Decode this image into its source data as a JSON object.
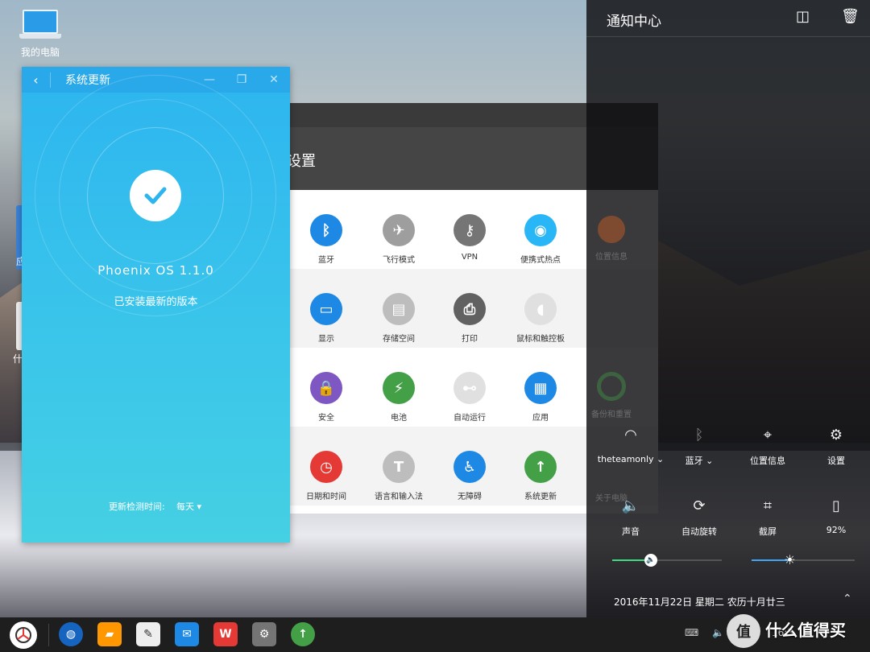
{
  "desktop": {
    "computer_label": "我的电脑",
    "peek_label_1": "应",
    "peek_label_2": "什"
  },
  "settings_window": {
    "title": "设置",
    "rows": [
      [
        {
          "label": "蓝牙",
          "icon": "bluetooth-icon",
          "color": "#1e88e5"
        },
        {
          "label": "飞行模式",
          "icon": "airplane-icon",
          "color": "#9e9e9e"
        },
        {
          "label": "VPN",
          "icon": "vpn-key-icon",
          "color": "#757575"
        },
        {
          "label": "便携式热点",
          "icon": "hotspot-icon",
          "color": "#29b6f6"
        }
      ],
      [
        {
          "label": "显示",
          "icon": "display-icon",
          "color": "#1e88e5"
        },
        {
          "label": "存储空间",
          "icon": "storage-icon",
          "color": "#bdbdbd"
        },
        {
          "label": "打印",
          "icon": "printer-icon",
          "color": "#616161"
        },
        {
          "label": "鼠标和触控板",
          "icon": "mouse-icon",
          "color": "#e0e0e0"
        }
      ],
      [
        {
          "label": "安全",
          "icon": "lock-icon",
          "color": "#7e57c2"
        },
        {
          "label": "电池",
          "icon": "battery-icon",
          "color": "#43a047"
        },
        {
          "label": "自动运行",
          "icon": "toggle-icon",
          "color": "#e0e0e0"
        },
        {
          "label": "应用",
          "icon": "apps-grid-icon",
          "color": "#1e88e5"
        }
      ],
      [
        {
          "label": "日期和时间",
          "icon": "clock-icon",
          "color": "#e53935"
        },
        {
          "label": "语言和输入法",
          "icon": "keyboard-text-icon",
          "color": "#bdbdbd"
        },
        {
          "label": "无障碍",
          "icon": "accessibility-icon",
          "color": "#1e88e5"
        },
        {
          "label": "系统更新",
          "icon": "upload-arrow-icon",
          "color": "#43a047"
        }
      ]
    ],
    "hidden_items": [
      "位置信息",
      "备份和重置",
      "关于电脑"
    ]
  },
  "update_window": {
    "title": "系统更新",
    "version": "Phoenix OS  1.1.0",
    "status": "已安装最新的版本",
    "check_interval_label": "更新检测时间:",
    "check_interval_value": "每天"
  },
  "notification_center": {
    "title": "通知中心",
    "quick_settings": [
      {
        "label": "theteamonly",
        "icon": "wifi-icon",
        "has_dropdown": true
      },
      {
        "label": "蓝牙",
        "icon": "bluetooth-icon",
        "has_dropdown": true
      },
      {
        "label": "位置信息",
        "icon": "location-icon",
        "has_dropdown": false
      },
      {
        "label": "设置",
        "icon": "gear-icon",
        "has_dropdown": false
      },
      {
        "label": "声音",
        "icon": "speaker-icon",
        "has_dropdown": false
      },
      {
        "label": "自动旋转",
        "icon": "rotate-icon",
        "has_dropdown": false
      },
      {
        "label": "截屏",
        "icon": "crop-icon",
        "has_dropdown": false
      },
      {
        "label": "92%",
        "icon": "battery-charging-icon",
        "has_dropdown": false
      }
    ],
    "volume_level": 0.35,
    "brightness_level": 0.37,
    "date": "2016年11月22日  星期二  农历十月廿三"
  },
  "taskbar": {
    "apps": [
      {
        "name": "browser",
        "icon": "globe-icon",
        "color": "#1565c0"
      },
      {
        "name": "files",
        "icon": "folder-icon",
        "color": "#ff9800"
      },
      {
        "name": "notes",
        "icon": "pencil-icon",
        "color": "#eeeeee"
      },
      {
        "name": "mail",
        "icon": "mail-icon",
        "color": "#1e88e5"
      },
      {
        "name": "wps",
        "icon": "wps-icon",
        "color": "#e53935"
      },
      {
        "name": "settings",
        "icon": "gear-icon",
        "color": "#757575"
      },
      {
        "name": "update",
        "icon": "upload-arrow-icon",
        "color": "#43a047"
      }
    ],
    "tray_time": "16:3",
    "watermark": "什么值得买"
  },
  "colors": {
    "update_bg": "#2db5ef",
    "notif_bg": "#0f0f11",
    "volume_accent": "#3ddc84",
    "brightness_accent": "#42a5f5"
  }
}
